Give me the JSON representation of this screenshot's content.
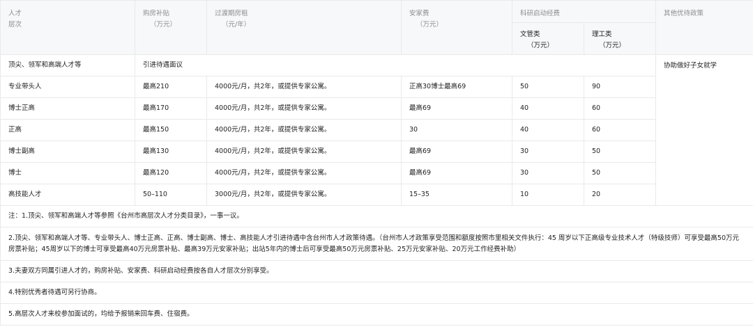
{
  "headers": {
    "level": [
      "人才",
      "层次"
    ],
    "housing": [
      "购房补贴",
      "（万元）"
    ],
    "rent": [
      "过渡期房租",
      "（元/年）"
    ],
    "settle": [
      "安家费",
      "（万元）"
    ],
    "research": "科研启动经费",
    "research_mgmt": [
      "文管类",
      "（万元）"
    ],
    "research_sci": [
      "理工类",
      "（万元）"
    ],
    "other": "其他优待政策"
  },
  "top_row": {
    "level": "顶尖、领军和高端人才等",
    "policy": "引进待遇面议",
    "other": "协助做好子女就学"
  },
  "rows": [
    {
      "level": "专业带头人",
      "housing": "最高210",
      "rent": "4000元/月，共2年，或提供专家公寓。",
      "settle": "正高30博士最高69",
      "mgmt": "50",
      "sci": "90"
    },
    {
      "level": "博士正高",
      "housing": "最高170",
      "rent": "4000元/月，共2年，或提供专家公寓。",
      "settle": "最高69",
      "mgmt": "40",
      "sci": "60"
    },
    {
      "level": "正高",
      "housing": "最高150",
      "rent": "4000元/月，共2年，或提供专家公寓。",
      "settle": "30",
      "mgmt": "40",
      "sci": "60"
    },
    {
      "level": "博士副高",
      "housing": "最高130",
      "rent": "4000元/月，共2年，或提供专家公寓。",
      "settle": "最高69",
      "mgmt": "30",
      "sci": "50"
    },
    {
      "level": "博士",
      "housing": "最高120",
      "rent": "4000元/月，共2年，或提供专家公寓。",
      "settle": "最高69",
      "mgmt": "30",
      "sci": "50"
    },
    {
      "level": "高技能人才",
      "housing": "50–110",
      "rent": "3000元/月，共2年，或提供专家公寓。",
      "settle": "15–35",
      "mgmt": "10",
      "sci": "20"
    }
  ],
  "notes": [
    "注：1.顶尖、领军和高端人才等参照《台州市高层次人才分类目录》，一事一议。",
    "2.顶尖、领军和高端人才等、专业带头人、博士正高、正高、博士副高、博士、高技能人才引进待遇中含台州市人才政策待遇。（台州市人才政策享受范围和额度按照市里相关文件执行：45 周岁以下正高级专业技术人才（特级技师）可享受最高50万元房票补贴；45周岁以下的博士可享受最高40万元房票补贴、最高39万元安家补贴；出站5年内的博士后可享受最高50万元房票补贴、25万元安家补贴、20万元工作经费补助）",
    "3.夫妻双方同属引进人才的，购房补贴、安家费、科研启动经费按各自人才层次分别享受。",
    "4.特别优秀者待遇可另行协商。",
    "5.高层次人才来校参加面试的，均给予报销来回车费、住宿费。"
  ]
}
